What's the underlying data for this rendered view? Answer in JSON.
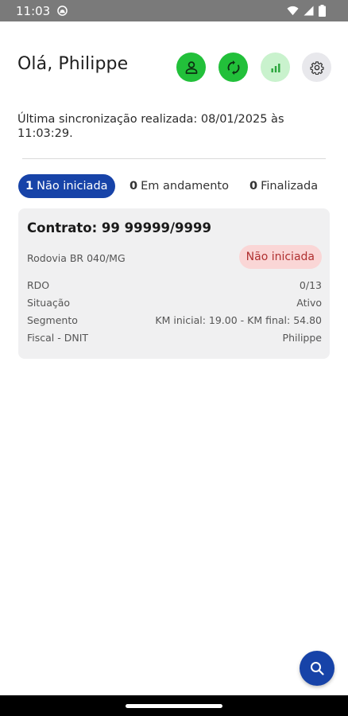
{
  "status_bar": {
    "time": "11:03",
    "icons": [
      "app-notification-icon",
      "wifi-icon",
      "signal-icon",
      "battery-icon"
    ]
  },
  "header": {
    "greeting": "Olá, Philippe",
    "actions": [
      "user-icon",
      "sync-icon",
      "signal-bars-icon",
      "gear-icon"
    ]
  },
  "sync": {
    "text": "Última sincronização realizada: 08/01/2025 às 11:03:29."
  },
  "tabs": [
    {
      "count": "1",
      "label": "Não iniciada",
      "active": true
    },
    {
      "count": "0",
      "label": "Em andamento",
      "active": false
    },
    {
      "count": "0",
      "label": "Finalizada",
      "active": false
    }
  ],
  "contract_card": {
    "title": "Contrato: 99 99999/9999",
    "road": "Rodovia BR 040/MG",
    "status": "Não iniciada",
    "rows": [
      {
        "label": "RDO",
        "value": "0/13"
      },
      {
        "label": "Situação",
        "value": "Ativo"
      },
      {
        "label": "Segmento",
        "value": "KM inicial: 19.00 - KM final: 54.80"
      },
      {
        "label": "Fiscal - DNIT",
        "value": "Philippe"
      }
    ]
  },
  "fab": {
    "icon": "search-icon"
  },
  "colors": {
    "primary": "#1743a8",
    "accent_green": "#22c03a",
    "light_green": "#c9f2cd",
    "status_badge_bg": "#fad6d6",
    "status_badge_text": "#b03030",
    "card_bg": "#f0f0f1"
  }
}
